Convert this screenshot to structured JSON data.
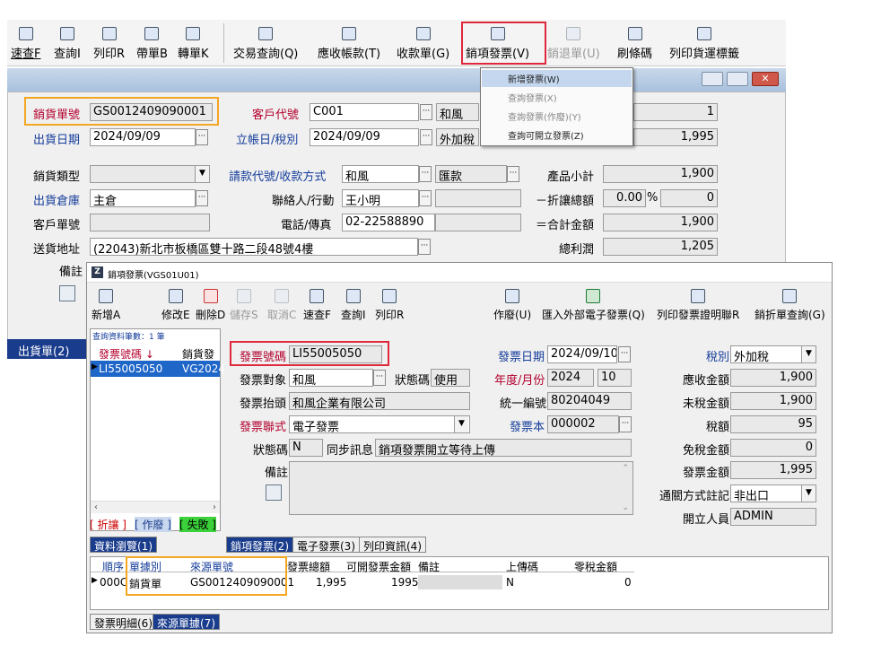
{
  "toolbar": {
    "quick": "速查F",
    "query": "查詢I",
    "print": "列印R",
    "carry": "帶單B",
    "transfer": "轉單K",
    "trade_query": "交易查詢(Q)",
    "receivable": "應收帳款(T)",
    "receipt": "收款單(G)",
    "sales_invoice": "銷項發票(V)",
    "sales_return": "銷退單(U)",
    "barcode": "刷條碼",
    "print_label": "列印貨運標籤"
  },
  "invoice_menu": {
    "items": [
      "新增發票(W)",
      "查詢發票(X)",
      "查詢發票(作廢)(Y)",
      "查詢可開立發票(Z)"
    ]
  },
  "order": {
    "no_label": "銷貨單號",
    "no": "GS0012409090001",
    "date_label": "出貨日期",
    "date": "2024/09/09",
    "cust_label": "客戶代號",
    "cust": "C001",
    "cust_name": "和風",
    "acct_label": "立帳日/稅別",
    "acct_date": "2024/09/09",
    "tax": "外加稅",
    "right1": "1",
    "right2": "1,995",
    "type_label": "銷貨類型",
    "warehouse_label": "出貨倉庫",
    "warehouse": "主倉",
    "custno_label": "客戶單號",
    "addr_label": "送貨地址",
    "addr": "(22043)新北市板橋區雙十路二段48號4樓",
    "note_label": "備註",
    "pay_label": "請款代號/收款方式",
    "pay_code": "和風",
    "pay_method": "匯款",
    "contact_label": "聯絡人/行動",
    "contact": "王小明",
    "phone_label": "電話/傳真",
    "phone": "02-22588890",
    "subtotal_label": "產品小計",
    "subtotal": "1,900",
    "discount_label": "－折讓總額",
    "discount_pct": "0.00",
    "pct": "%",
    "discount": "0",
    "total_label": "＝合計金額",
    "total": "1,900",
    "profit_label": "總利潤",
    "profit": "1,205",
    "bottom_tab": "出貨單(2)"
  },
  "inv": {
    "title": "銷項發票(VGS01U01)",
    "tools": {
      "add": "新增A",
      "edit": "修改E",
      "delete": "刪除D",
      "save": "儲存S",
      "cancel": "取消C",
      "quick": "速查F",
      "query": "查詢I",
      "print": "列印R",
      "void": "作廢(U)",
      "import": "匯入外部電子發票(Q)",
      "print_proof": "列印發票證明聯R",
      "discount_query": "銷折單查詢(G)"
    },
    "list_header": "查詢資料筆數：1 筆",
    "list_col1": "發票號碼 ↓",
    "list_col2": "銷貨發",
    "list_row1": "LI55005050",
    "list_row2": "VG2024",
    "legend": [
      "[ 折讓 ]",
      "[ 作廢 ]",
      "[ 失敗 ]"
    ],
    "no_label": "發票號碼",
    "no": "LI55005050",
    "obj_label": "發票對象",
    "obj": "和風",
    "status_label": "狀態碼",
    "status": "使用",
    "head_label": "發票抬頭",
    "head": "和風企業有限公司",
    "type_label": "發票聯式",
    "type": "電子發票",
    "stat2_label": "狀態碼",
    "stat2": "N",
    "sync_label": "同步訊息",
    "sync": "銷項發票開立等待上傳",
    "note_label": "備註",
    "date_label": "發票日期",
    "date": "2024/09/10",
    "ym_label": "年度/月份",
    "year": "2024",
    "month": "10",
    "vat_label": "統一編號",
    "vat": "80204049",
    "book_label": "發票本",
    "book": "000002",
    "taxtype_label": "稅別",
    "taxtype": "外加稅",
    "recv_label": "應收金額",
    "recv": "1,900",
    "untaxed_label": "未稅金額",
    "untaxed": "1,900",
    "taxamt_label": "稅額",
    "taxamt": "95",
    "exempt_label": "免稅金額",
    "exempt": "0",
    "amount_label": "發票金額",
    "amount": "1,995",
    "customs_label": "通關方式註記",
    "customs": "非出口",
    "creator_label": "開立人員",
    "creator": "ADMIN",
    "tabs_left": "資料瀏覽(1)",
    "tabs": [
      "銷項發票(2)",
      "電子發票(3)",
      "列印資訊(4)"
    ],
    "grid_headers": [
      "順序",
      "單據別",
      "來源單號",
      "發票總額",
      "可開發票金額",
      "備註",
      "上傳碼",
      "零稅金額"
    ],
    "grid_row": [
      "000C",
      "銷貨單",
      "GS0012409090001",
      "1,995",
      "1995",
      "",
      "N",
      "0"
    ],
    "bottom_tabs": [
      "發票明細(6)",
      "來源單據(7)"
    ]
  }
}
